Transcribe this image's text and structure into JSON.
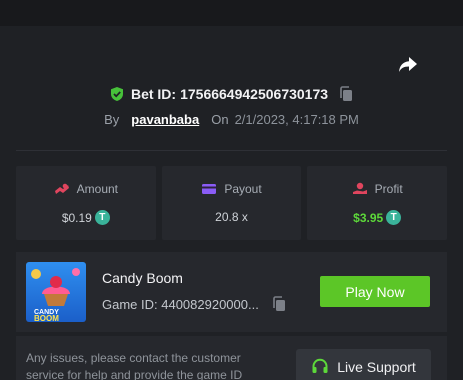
{
  "bet": {
    "id_label": "Bet ID:",
    "id_value": "1756664942506730173",
    "by_label": "By",
    "username": "pavanbaba",
    "on_label": "On",
    "date": "2/1/2023, 4:17:18 PM"
  },
  "stats": {
    "amount": {
      "label": "Amount",
      "value": "$0.19",
      "currency_icon": "tether-icon"
    },
    "payout": {
      "label": "Payout",
      "value": "20.8 x"
    },
    "profit": {
      "label": "Profit",
      "value": "$3.95",
      "currency_icon": "tether-icon"
    }
  },
  "game": {
    "name": "Candy Boom",
    "id_text": "Game ID: 440082920000...",
    "play_label": "Play Now",
    "thumb_logo_line1": "CANDY",
    "thumb_logo_line2": "BOOM"
  },
  "support": {
    "text": "Any issues, please contact the customer service for help and provide the game ID",
    "button_label": "Live Support"
  },
  "colors": {
    "accent_green": "#5cc627",
    "profit_green": "#5dd83a",
    "shield_green": "#47c13a",
    "amount_icon": "#e0455e",
    "payout_icon": "#8a5cf6",
    "profit_icon": "#e0455e"
  }
}
